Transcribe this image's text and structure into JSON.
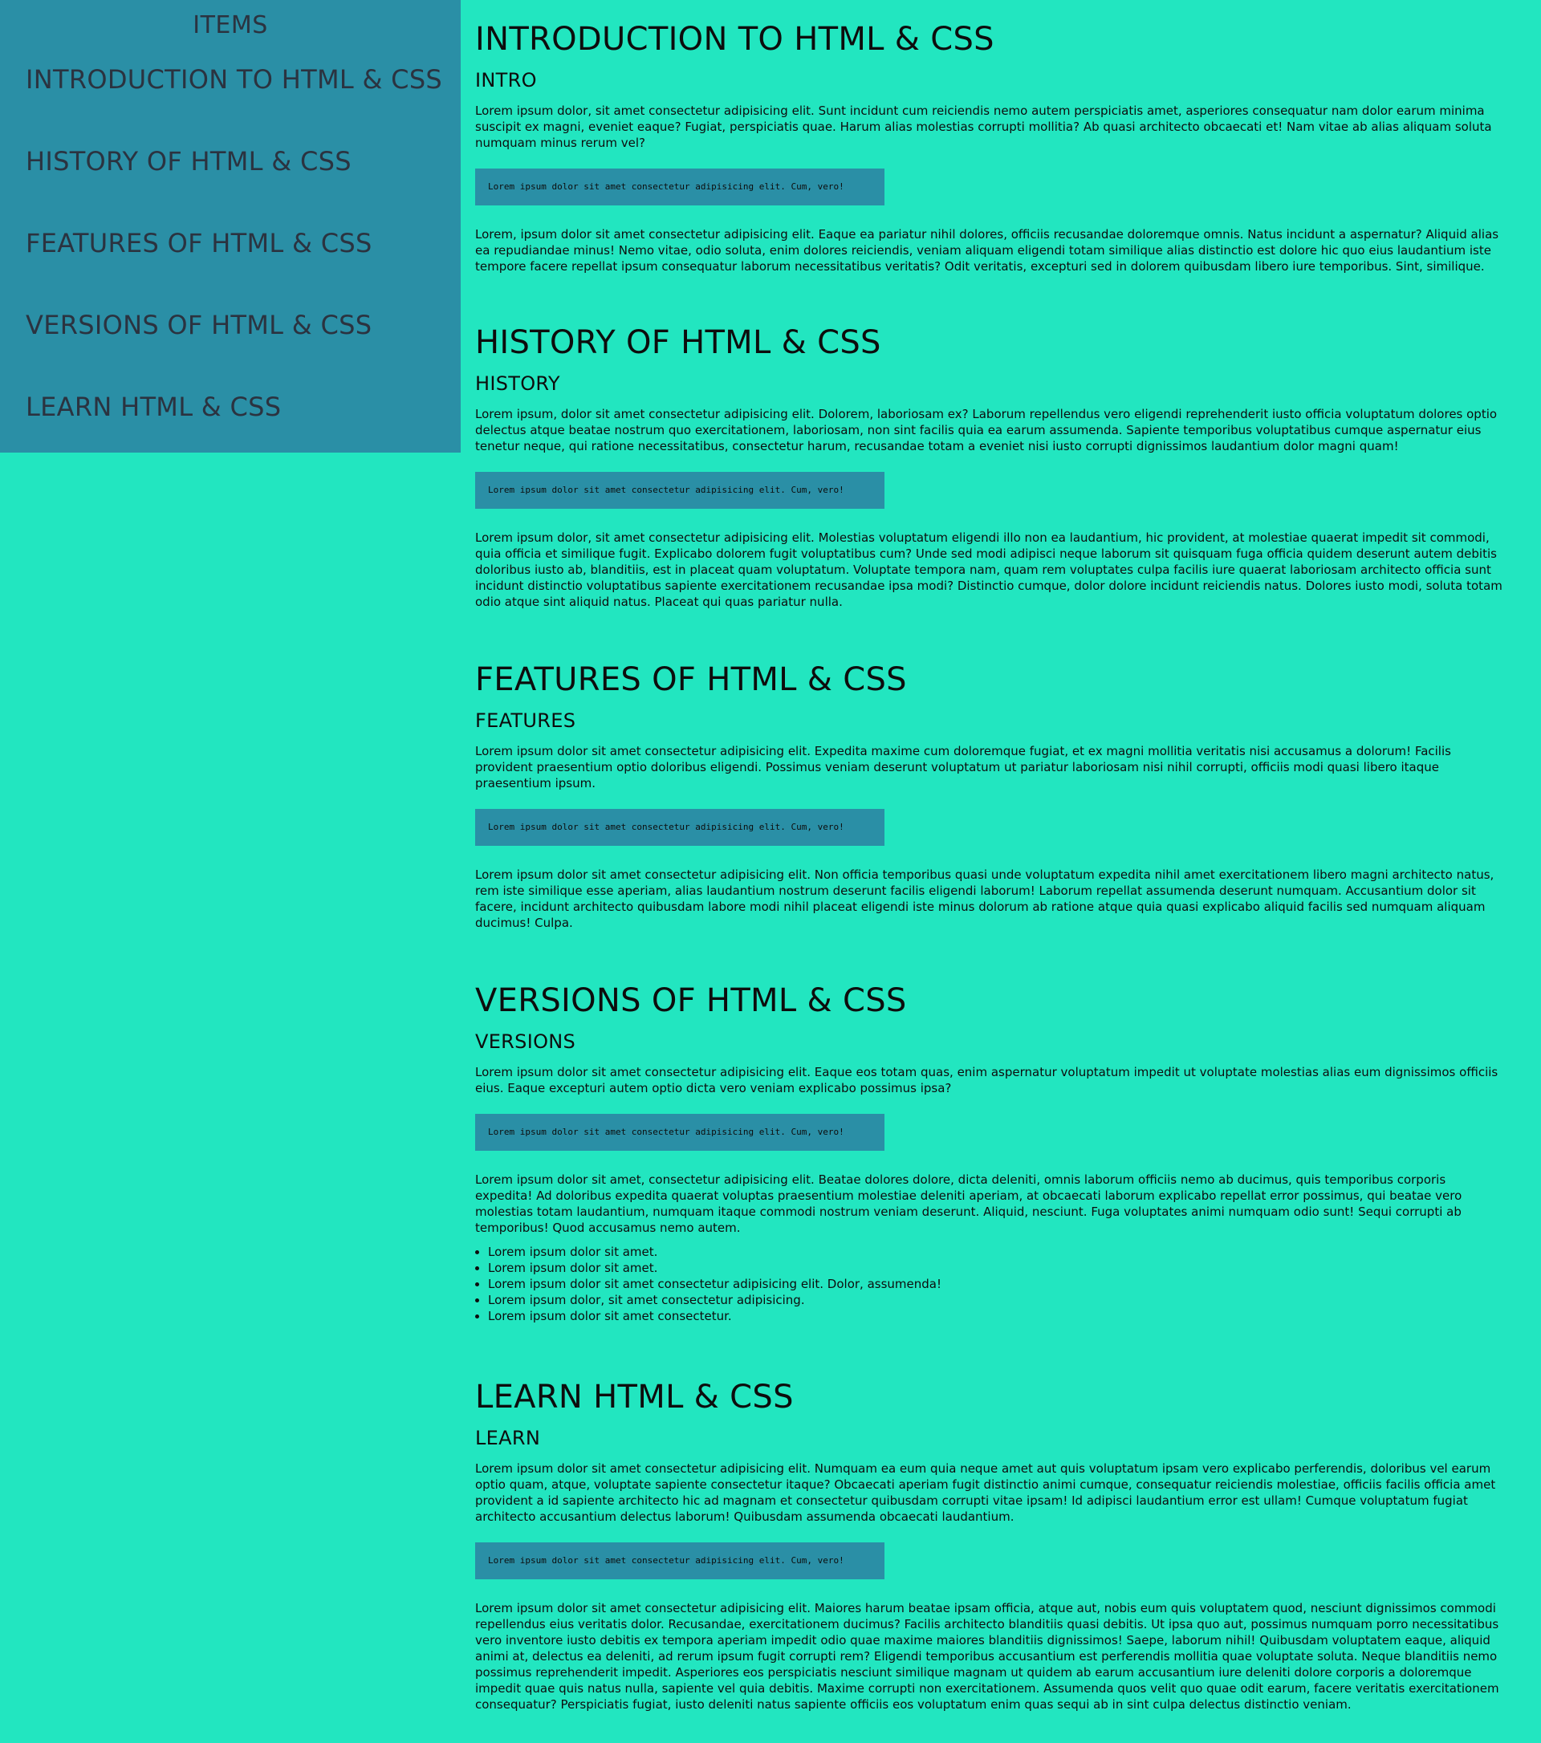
{
  "navbar": {
    "header": "ITEMS",
    "items": [
      {
        "label": "INTRODUCTION TO HTML & CSS"
      },
      {
        "label": "HISTORY OF HTML & CSS"
      },
      {
        "label": "FEATURES OF HTML & CSS"
      },
      {
        "label": "VERSIONS OF HTML & CSS"
      },
      {
        "label": "LEARN HTML & CSS"
      }
    ]
  },
  "sections": [
    {
      "title": "INTRODUCTION TO HTML & CSS",
      "subtitle": "INTRO",
      "para1": "Lorem ipsum dolor, sit amet consectetur adipisicing elit. Sunt incidunt cum reiciendis nemo autem perspiciatis amet, asperiores consequatur nam dolor earum minima suscipit ex magni, eveniet eaque? Fugiat, perspiciatis quae. Harum alias molestias corrupti mollitia? Ab quasi architecto obcaecati et! Nam vitae ab alias aliquam soluta numquam minus rerum vel?",
      "code": "Lorem ipsum dolor sit amet consectetur adipisicing elit. Cum, vero!",
      "para2": "Lorem, ipsum dolor sit amet consectetur adipisicing elit. Eaque ea pariatur nihil dolores, officiis recusandae doloremque omnis. Natus incidunt a aspernatur? Aliquid alias ea repudiandae minus! Nemo vitae, odio soluta, enim dolores reiciendis, veniam aliquam eligendi totam similique alias distinctio est dolore hic quo eius laudantium iste tempore facere repellat ipsum consequatur laborum necessitatibus veritatis? Odit veritatis, excepturi sed in dolorem quibusdam libero iure temporibus. Sint, similique."
    },
    {
      "title": "HISTORY OF HTML & CSS",
      "subtitle": "HISTORY",
      "para1": "Lorem ipsum, dolor sit amet consectetur adipisicing elit. Dolorem, laboriosam ex? Laborum repellendus vero eligendi reprehenderit iusto officia voluptatum dolores optio delectus atque beatae nostrum quo exercitationem, laboriosam, non sint facilis quia ea earum assumenda. Sapiente temporibus voluptatibus cumque aspernatur eius tenetur neque, qui ratione necessitatibus, consectetur harum, recusandae totam a eveniet nisi iusto corrupti dignissimos laudantium dolor magni quam!",
      "code": "Lorem ipsum dolor sit amet consectetur adipisicing elit. Cum, vero!",
      "para2": "Lorem ipsum dolor, sit amet consectetur adipisicing elit. Molestias voluptatum eligendi illo non ea laudantium, hic provident, at molestiae quaerat impedit sit commodi, quia officia et similique fugit. Explicabo dolorem fugit voluptatibus cum? Unde sed modi adipisci neque laborum sit quisquam fuga officia quidem deserunt autem debitis doloribus iusto ab, blanditiis, est in placeat quam voluptatum. Voluptate tempora nam, quam rem voluptates culpa facilis iure quaerat laboriosam architecto officia sunt incidunt distinctio voluptatibus sapiente exercitationem recusandae ipsa modi? Distinctio cumque, dolor dolore incidunt reiciendis natus. Dolores iusto modi, soluta totam odio atque sint aliquid natus. Placeat qui quas pariatur nulla."
    },
    {
      "title": "FEATURES OF HTML & CSS",
      "subtitle": "FEATURES",
      "para1": "Lorem ipsum dolor sit amet consectetur adipisicing elit. Expedita maxime cum doloremque fugiat, et ex magni mollitia veritatis nisi accusamus a dolorum! Facilis provident praesentium optio doloribus eligendi. Possimus veniam deserunt voluptatum ut pariatur laboriosam nisi nihil corrupti, officiis modi quasi libero itaque praesentium ipsum.",
      "code": "Lorem ipsum dolor sit amet consectetur adipisicing elit. Cum, vero!",
      "para2": "Lorem ipsum dolor sit amet consectetur adipisicing elit. Non officia temporibus quasi unde voluptatum expedita nihil amet exercitationem libero magni architecto natus, rem iste similique esse aperiam, alias laudantium nostrum deserunt facilis eligendi laborum! Laborum repellat assumenda deserunt numquam. Accusantium dolor sit facere, incidunt architecto quibusdam labore modi nihil placeat eligendi iste minus dolorum ab ratione atque quia quasi explicabo aliquid facilis sed numquam aliquam ducimus! Culpa."
    },
    {
      "title": "VERSIONS OF HTML & CSS",
      "subtitle": "VERSIONS",
      "para1": "Lorem ipsum dolor sit amet consectetur adipisicing elit. Eaque eos totam quas, enim aspernatur voluptatum impedit ut voluptate molestias alias eum dignissimos officiis eius. Eaque excepturi autem optio dicta vero veniam explicabo possimus ipsa?",
      "code": "Lorem ipsum dolor sit amet consectetur adipisicing elit. Cum, vero!",
      "para2": "Lorem ipsum dolor sit amet, consectetur adipisicing elit. Beatae dolores dolore, dicta deleniti, omnis laborum officiis nemo ab ducimus, quis temporibus corporis expedita! Ad doloribus expedita quaerat voluptas praesentium molestiae deleniti aperiam, at obcaecati laborum explicabo repellat error possimus, qui beatae vero molestias totam laudantium, numquam itaque commodi nostrum veniam deserunt. Aliquid, nesciunt. Fuga voluptates animi numquam odio sunt! Sequi corrupti ab temporibus! Quod accusamus nemo autem.",
      "list": [
        "Lorem ipsum dolor sit amet.",
        "Lorem ipsum dolor sit amet.",
        "Lorem ipsum dolor sit amet consectetur adipisicing elit. Dolor, assumenda!",
        "Lorem ipsum dolor, sit amet consectetur adipisicing.",
        "Lorem ipsum dolor sit amet consectetur."
      ]
    },
    {
      "title": "LEARN HTML & CSS",
      "subtitle": "LEARN",
      "para1": "Lorem ipsum dolor sit amet consectetur adipisicing elit. Numquam ea eum quia neque amet aut quis voluptatum ipsam vero explicabo perferendis, doloribus vel earum optio quam, atque, voluptate sapiente consectetur itaque? Obcaecati aperiam fugit distinctio animi cumque, consequatur reiciendis molestiae, officiis facilis officia amet provident a id sapiente architecto hic ad magnam et consectetur quibusdam corrupti vitae ipsam! Id adipisci laudantium error est ullam! Cumque voluptatum fugiat architecto accusantium delectus laborum! Quibusdam assumenda obcaecati laudantium.",
      "code": "Lorem ipsum dolor sit amet consectetur adipisicing elit. Cum, vero!",
      "para2": "Lorem ipsum dolor sit amet consectetur adipisicing elit. Maiores harum beatae ipsam officia, atque aut, nobis eum quis voluptatem quod, nesciunt dignissimos commodi repellendus eius veritatis dolor. Recusandae, exercitationem ducimus? Facilis architecto blanditiis quasi debitis. Ut ipsa quo aut, possimus numquam porro necessitatibus vero inventore iusto debitis ex tempora aperiam impedit odio quae maxime maiores blanditiis dignissimos! Saepe, laborum nihil! Quibusdam voluptatem eaque, aliquid animi at, delectus ea deleniti, ad rerum ipsum fugit corrupti rem? Eligendi temporibus accusantium est perferendis mollitia quae voluptate soluta. Neque blanditiis nemo possimus reprehenderit impedit. Asperiores eos perspiciatis nesciunt similique magnam ut quidem ab earum accusantium iure deleniti dolore corporis a doloremque impedit quae quis natus nulla, sapiente vel quia debitis. Maxime corrupti non exercitationem. Assumenda quos velit quo quae odit earum, facere veritatis exercitationem consequatur? Perspiciatis fugiat, iusto deleniti natus sapiente officiis eos voluptatum enim quas sequi ab in sint culpa delectus distinctio veniam."
    }
  ],
  "colors": {
    "page_background": "#22e6c0",
    "sidebar_background": "#2a8fa6",
    "code_background": "#2a8fa6",
    "nav_text": "#2b3340",
    "body_text": "#0d0d0d"
  }
}
